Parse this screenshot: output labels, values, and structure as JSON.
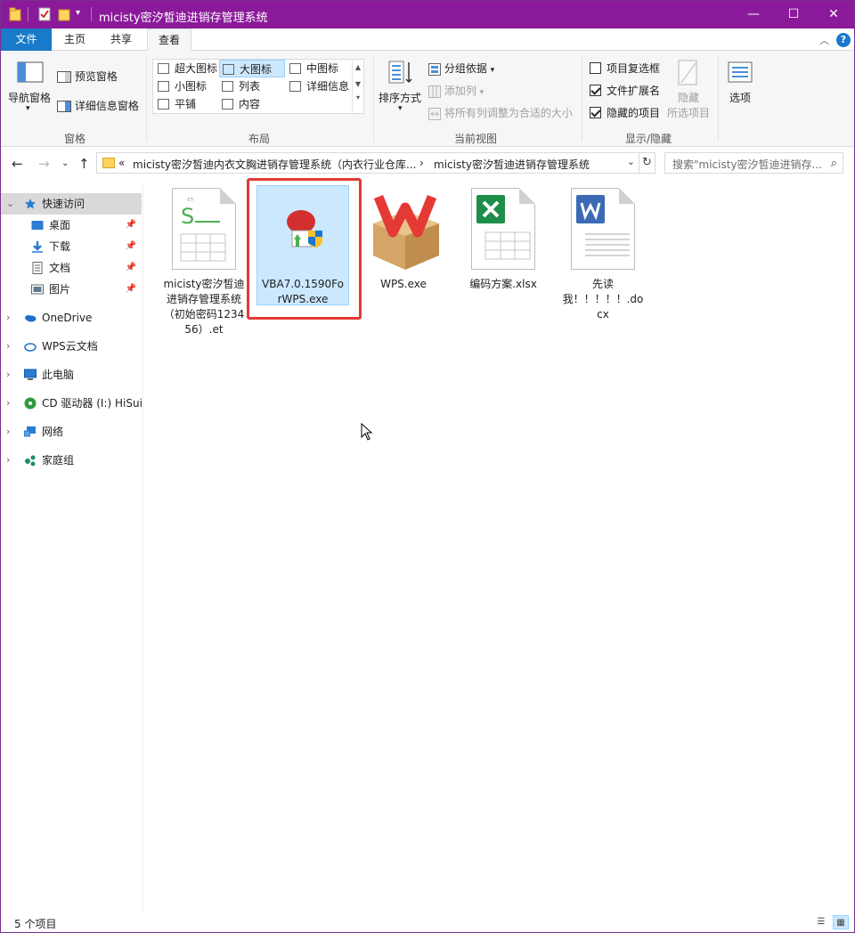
{
  "window": {
    "title": "micisty密汐皙迪进销存管理系统",
    "controls": {
      "minimize": "—",
      "maximize": "☐",
      "close": "✕"
    }
  },
  "tabs": [
    "文件",
    "主页",
    "共享",
    "查看"
  ],
  "ribbon": {
    "pane": {
      "nav_pane": "导航窗格",
      "preview_pane": "预览窗格",
      "details_pane": "详细信息窗格",
      "group_label": "窗格"
    },
    "layout": {
      "items": [
        "超大图标",
        "大图标",
        "中图标",
        "小图标",
        "列表",
        "详细信息",
        "平铺",
        "内容"
      ],
      "selected": "大图标",
      "group_label": "布局"
    },
    "current_view": {
      "sort_by": "排序方式",
      "group_by": "分组依据",
      "add_columns": "添加列",
      "size_columns": "将所有列调整为合适的大小",
      "group_label": "当前视图"
    },
    "show_hide": {
      "item_checkboxes": {
        "label": "项目复选框",
        "checked": false
      },
      "file_extensions": {
        "label": "文件扩展名",
        "checked": true
      },
      "hidden_items": {
        "label": "隐藏的项目",
        "checked": true
      },
      "hide_selected": "隐藏",
      "hide_selected_2": "所选项目",
      "group_label": "显示/隐藏"
    },
    "options": "选项"
  },
  "address": {
    "prefix": "«",
    "crumb1": "micisty密汐皙迪内衣文胸进销存管理系统（内衣行业仓库...",
    "sep": "›",
    "crumb2": "micisty密汐皙迪进销存管理系统",
    "search_placeholder": "搜索\"micisty密汐皙迪进销存..."
  },
  "nav": {
    "quick_access": "快速访问",
    "desktop": "桌面",
    "downloads": "下载",
    "documents": "文档",
    "pictures": "图片",
    "onedrive": "OneDrive",
    "wps_cloud": "WPS云文档",
    "this_pc": "此电脑",
    "cd_drive": "CD 驱动器 (I:) HiSuite",
    "network": "网络",
    "homegroup": "家庭组"
  },
  "files": [
    {
      "name": "micisty密汐皙迪进销存管理系统（初始密码123456）.et",
      "type": "et"
    },
    {
      "name": "VBA7.0.1590ForWPS.exe",
      "type": "installer"
    },
    {
      "name": "WPS.exe",
      "type": "wps"
    },
    {
      "name": "编码方案.xlsx",
      "type": "xlsx"
    },
    {
      "name": "先读我！！！！！.docx",
      "type": "docx"
    }
  ],
  "status": {
    "count": "5 个项目"
  },
  "colors": {
    "title_bar": "#8b1a9a",
    "file_tab": "#1979ca",
    "highlight": "#e53935",
    "selection": "#cce8ff"
  }
}
